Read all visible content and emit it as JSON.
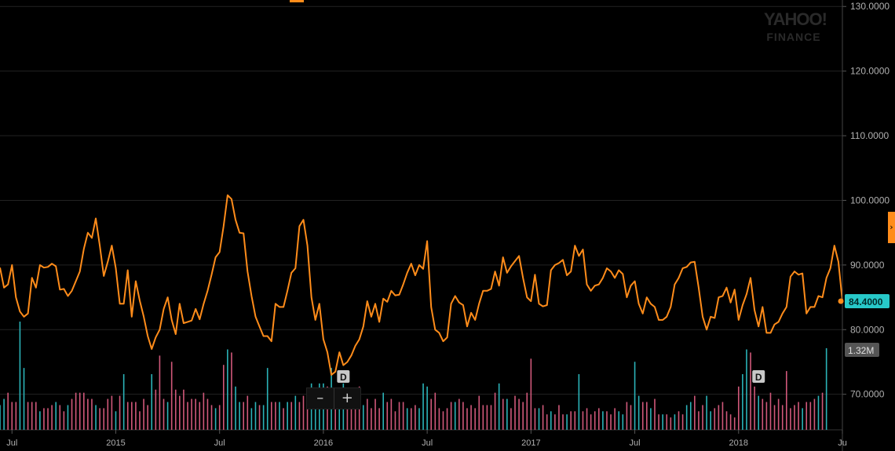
{
  "branding": {
    "logo_top": "YAHOO!",
    "logo_bottom": "FINANCE"
  },
  "zoom": {
    "minus": "–",
    "plus": "+"
  },
  "side_tab": {
    "label": "›"
  },
  "colors": {
    "line": "#ff8c1a",
    "vol_up": "#2bb3b8",
    "vol_down": "#d0587a",
    "price_badge": "#27c9c9",
    "volume_badge": "#555555",
    "grid": "#222222"
  },
  "chart_data": {
    "type": "line",
    "ylim": [
      64.5,
      131
    ],
    "y_ticks": [
      "130.0000",
      "120.0000",
      "110.0000",
      "100.0000",
      "90.0000",
      "80.0000",
      "70.0000"
    ],
    "y_tick_values": [
      130,
      120,
      110,
      100,
      90,
      80,
      70
    ],
    "x_labels": [
      "Jul",
      "2015",
      "Jul",
      "2016",
      "Jul",
      "2017",
      "Jul",
      "2018",
      "Ju"
    ],
    "x_label_index": [
      3,
      29,
      55,
      81,
      107,
      133,
      159,
      185,
      211
    ],
    "current_price_label": "84.4000",
    "current_volume_label": "1.32M",
    "dividend_marker": "D",
    "dividend_index": [
      86,
      190
    ],
    "price_series": [
      89.6,
      86.5,
      87.0,
      90.0,
      85.0,
      82.8,
      82.0,
      82.5,
      88.0,
      86.5,
      90.0,
      89.6,
      89.7,
      90.2,
      89.8,
      86.2,
      86.3,
      85.2,
      86.0,
      87.5,
      89.0,
      92.5,
      95.0,
      94.2,
      97.2,
      93.0,
      88.3,
      90.5,
      93.0,
      89.5,
      84.0,
      84.0,
      89.2,
      82.0,
      87.5,
      84.5,
      82.0,
      79.0,
      77.0,
      78.8,
      80.0,
      83.2,
      85.0,
      81.5,
      79.3,
      84.0,
      81.0,
      81.2,
      81.4,
      83.2,
      81.6,
      84.0,
      86.0,
      88.5,
      91.2,
      92.0,
      96.0,
      100.8,
      100.2,
      97.0,
      95.0,
      94.9,
      89.0,
      85.2,
      82.0,
      80.5,
      79.0,
      79.0,
      78.2,
      84.0,
      83.5,
      83.5,
      86.0,
      88.8,
      89.5,
      96.0,
      97.0,
      93.0,
      85.0,
      81.5,
      84.0,
      78.5,
      76.5,
      73.0,
      73.5,
      76.5,
      74.5,
      75.0,
      76.0,
      77.5,
      78.5,
      80.5,
      84.4,
      82.0,
      84.0,
      81.2,
      84.8,
      84.3,
      86.0,
      85.3,
      85.4,
      87.0,
      88.8,
      90.2,
      88.4,
      90.0,
      89.4,
      93.7,
      83.5,
      80.0,
      79.5,
      78.2,
      78.8,
      84.0,
      85.2,
      84.2,
      83.8,
      80.5,
      82.6,
      81.5,
      84.0,
      86.0,
      86.0,
      86.3,
      89.0,
      86.8,
      91.2,
      88.8,
      89.8,
      90.6,
      91.4,
      88.0,
      85.0,
      84.4,
      88.5,
      84.0,
      83.6,
      83.8,
      89.2,
      90.0,
      90.3,
      90.8,
      88.4,
      89.0,
      93.0,
      91.4,
      92.4,
      87.0,
      86.0,
      86.8,
      87.0,
      88.0,
      89.5,
      89.0,
      88.0,
      89.2,
      88.6,
      85.0,
      86.8,
      87.5,
      84.0,
      82.5,
      85.0,
      84.0,
      83.5,
      81.5,
      81.5,
      82.0,
      83.5,
      87.0,
      88.0,
      89.5,
      89.7,
      90.4,
      90.5,
      86.5,
      82.0,
      80.0,
      82.0,
      81.8,
      85.0,
      85.2,
      86.5,
      84.2,
      86.2,
      81.5,
      83.8,
      85.5,
      88.0,
      83.0,
      80.5,
      83.5,
      79.5,
      79.5,
      80.8,
      81.2,
      82.5,
      83.5,
      88.2,
      89.0,
      88.5,
      88.7,
      82.5,
      83.5,
      83.5,
      85.2,
      85.0,
      88.0,
      89.5,
      93.0,
      90.5,
      84.4
    ],
    "volume_series": [
      [
        0.4,
        0
      ],
      [
        0.5,
        0
      ],
      [
        0.6,
        1
      ],
      [
        0.45,
        1
      ],
      [
        0.45,
        1
      ],
      [
        1.75,
        0
      ],
      [
        1.0,
        0
      ],
      [
        0.45,
        1
      ],
      [
        0.45,
        1
      ],
      [
        0.45,
        1
      ],
      [
        0.3,
        0
      ],
      [
        0.35,
        1
      ],
      [
        0.35,
        1
      ],
      [
        0.4,
        1
      ],
      [
        0.45,
        0
      ],
      [
        0.4,
        1
      ],
      [
        0.3,
        1
      ],
      [
        0.4,
        0
      ],
      [
        0.5,
        1
      ],
      [
        0.6,
        1
      ],
      [
        0.6,
        1
      ],
      [
        0.6,
        1
      ],
      [
        0.5,
        1
      ],
      [
        0.5,
        1
      ],
      [
        0.4,
        0
      ],
      [
        0.35,
        1
      ],
      [
        0.35,
        1
      ],
      [
        0.5,
        1
      ],
      [
        0.55,
        1
      ],
      [
        0.3,
        0
      ],
      [
        0.55,
        1
      ],
      [
        0.9,
        0
      ],
      [
        0.45,
        1
      ],
      [
        0.45,
        1
      ],
      [
        0.45,
        1
      ],
      [
        0.3,
        1
      ],
      [
        0.5,
        1
      ],
      [
        0.4,
        1
      ],
      [
        0.9,
        0
      ],
      [
        0.65,
        1
      ],
      [
        1.2,
        1
      ],
      [
        0.5,
        1
      ],
      [
        0.45,
        0
      ],
      [
        1.1,
        1
      ],
      [
        0.65,
        1
      ],
      [
        0.55,
        1
      ],
      [
        0.65,
        1
      ],
      [
        0.45,
        1
      ],
      [
        0.5,
        1
      ],
      [
        0.5,
        1
      ],
      [
        0.45,
        1
      ],
      [
        0.6,
        1
      ],
      [
        0.5,
        1
      ],
      [
        0.4,
        1
      ],
      [
        0.35,
        0
      ],
      [
        0.4,
        1
      ],
      [
        1.05,
        1
      ],
      [
        1.3,
        0
      ],
      [
        1.25,
        1
      ],
      [
        0.7,
        0
      ],
      [
        0.45,
        0
      ],
      [
        0.45,
        1
      ],
      [
        0.55,
        1
      ],
      [
        0.35,
        0
      ],
      [
        0.45,
        0
      ],
      [
        0.4,
        1
      ],
      [
        0.4,
        0
      ],
      [
        1.0,
        0
      ],
      [
        0.45,
        1
      ],
      [
        0.45,
        1
      ],
      [
        0.45,
        0
      ],
      [
        0.35,
        1
      ],
      [
        0.45,
        0
      ],
      [
        0.45,
        1
      ],
      [
        0.55,
        0
      ],
      [
        0.45,
        1
      ],
      [
        0.55,
        1
      ],
      [
        0.4,
        1
      ],
      [
        0.75,
        0
      ],
      [
        0.5,
        0
      ],
      [
        0.75,
        0
      ],
      [
        0.75,
        0
      ],
      [
        0.7,
        1
      ],
      [
        1.0,
        0
      ],
      [
        0.55,
        1
      ],
      [
        0.55,
        0
      ],
      [
        0.75,
        0
      ],
      [
        0.5,
        1
      ],
      [
        0.45,
        1
      ],
      [
        0.45,
        1
      ],
      [
        0.7,
        1
      ],
      [
        0.4,
        0
      ],
      [
        0.5,
        1
      ],
      [
        0.35,
        1
      ],
      [
        0.5,
        1
      ],
      [
        0.35,
        1
      ],
      [
        0.6,
        0
      ],
      [
        0.45,
        1
      ],
      [
        0.5,
        1
      ],
      [
        0.3,
        1
      ],
      [
        0.45,
        1
      ],
      [
        0.45,
        1
      ],
      [
        0.35,
        0
      ],
      [
        0.35,
        1
      ],
      [
        0.4,
        1
      ],
      [
        0.35,
        0
      ],
      [
        0.75,
        0
      ],
      [
        0.7,
        0
      ],
      [
        0.5,
        1
      ],
      [
        0.6,
        1
      ],
      [
        0.35,
        1
      ],
      [
        0.3,
        1
      ],
      [
        0.35,
        1
      ],
      [
        0.45,
        1
      ],
      [
        0.45,
        0
      ],
      [
        0.5,
        1
      ],
      [
        0.45,
        1
      ],
      [
        0.35,
        1
      ],
      [
        0.4,
        1
      ],
      [
        0.35,
        1
      ],
      [
        0.55,
        1
      ],
      [
        0.4,
        1
      ],
      [
        0.4,
        1
      ],
      [
        0.4,
        1
      ],
      [
        0.6,
        1
      ],
      [
        0.75,
        0
      ],
      [
        0.5,
        1
      ],
      [
        0.5,
        0
      ],
      [
        0.35,
        1
      ],
      [
        0.55,
        1
      ],
      [
        0.5,
        1
      ],
      [
        0.45,
        1
      ],
      [
        0.6,
        1
      ],
      [
        1.15,
        1
      ],
      [
        0.35,
        1
      ],
      [
        0.35,
        0
      ],
      [
        0.4,
        1
      ],
      [
        0.25,
        1
      ],
      [
        0.3,
        0
      ],
      [
        0.25,
        1
      ],
      [
        0.4,
        1
      ],
      [
        0.25,
        1
      ],
      [
        0.25,
        0
      ],
      [
        0.3,
        1
      ],
      [
        0.3,
        1
      ],
      [
        0.9,
        0
      ],
      [
        0.3,
        1
      ],
      [
        0.35,
        1
      ],
      [
        0.25,
        1
      ],
      [
        0.3,
        1
      ],
      [
        0.35,
        1
      ],
      [
        0.3,
        0
      ],
      [
        0.3,
        1
      ],
      [
        0.25,
        1
      ],
      [
        0.35,
        1
      ],
      [
        0.3,
        0
      ],
      [
        0.25,
        0
      ],
      [
        0.45,
        1
      ],
      [
        0.4,
        1
      ],
      [
        1.1,
        0
      ],
      [
        0.55,
        0
      ],
      [
        0.45,
        1
      ],
      [
        0.45,
        1
      ],
      [
        0.35,
        0
      ],
      [
        0.5,
        1
      ],
      [
        0.25,
        1
      ],
      [
        0.25,
        0
      ],
      [
        0.25,
        1
      ],
      [
        0.2,
        1
      ],
      [
        0.25,
        0
      ],
      [
        0.3,
        1
      ],
      [
        0.25,
        1
      ],
      [
        0.4,
        0
      ],
      [
        0.45,
        0
      ],
      [
        0.55,
        1
      ],
      [
        0.3,
        1
      ],
      [
        0.4,
        1
      ],
      [
        0.55,
        0
      ],
      [
        0.3,
        0
      ],
      [
        0.35,
        1
      ],
      [
        0.4,
        1
      ],
      [
        0.45,
        1
      ],
      [
        0.3,
        1
      ],
      [
        0.25,
        1
      ],
      [
        0.2,
        1
      ],
      [
        0.7,
        1
      ],
      [
        0.9,
        0
      ],
      [
        1.3,
        0
      ],
      [
        1.25,
        1
      ],
      [
        0.7,
        1
      ],
      [
        0.55,
        0
      ],
      [
        0.5,
        1
      ],
      [
        0.45,
        1
      ],
      [
        0.6,
        1
      ],
      [
        0.4,
        1
      ],
      [
        0.5,
        1
      ],
      [
        0.4,
        1
      ],
      [
        0.95,
        1
      ],
      [
        0.35,
        1
      ],
      [
        0.4,
        1
      ],
      [
        0.45,
        1
      ],
      [
        0.35,
        0
      ],
      [
        0.45,
        1
      ],
      [
        0.45,
        1
      ],
      [
        0.5,
        1
      ],
      [
        0.55,
        0
      ],
      [
        0.6,
        1
      ],
      [
        1.32,
        0
      ]
    ]
  }
}
